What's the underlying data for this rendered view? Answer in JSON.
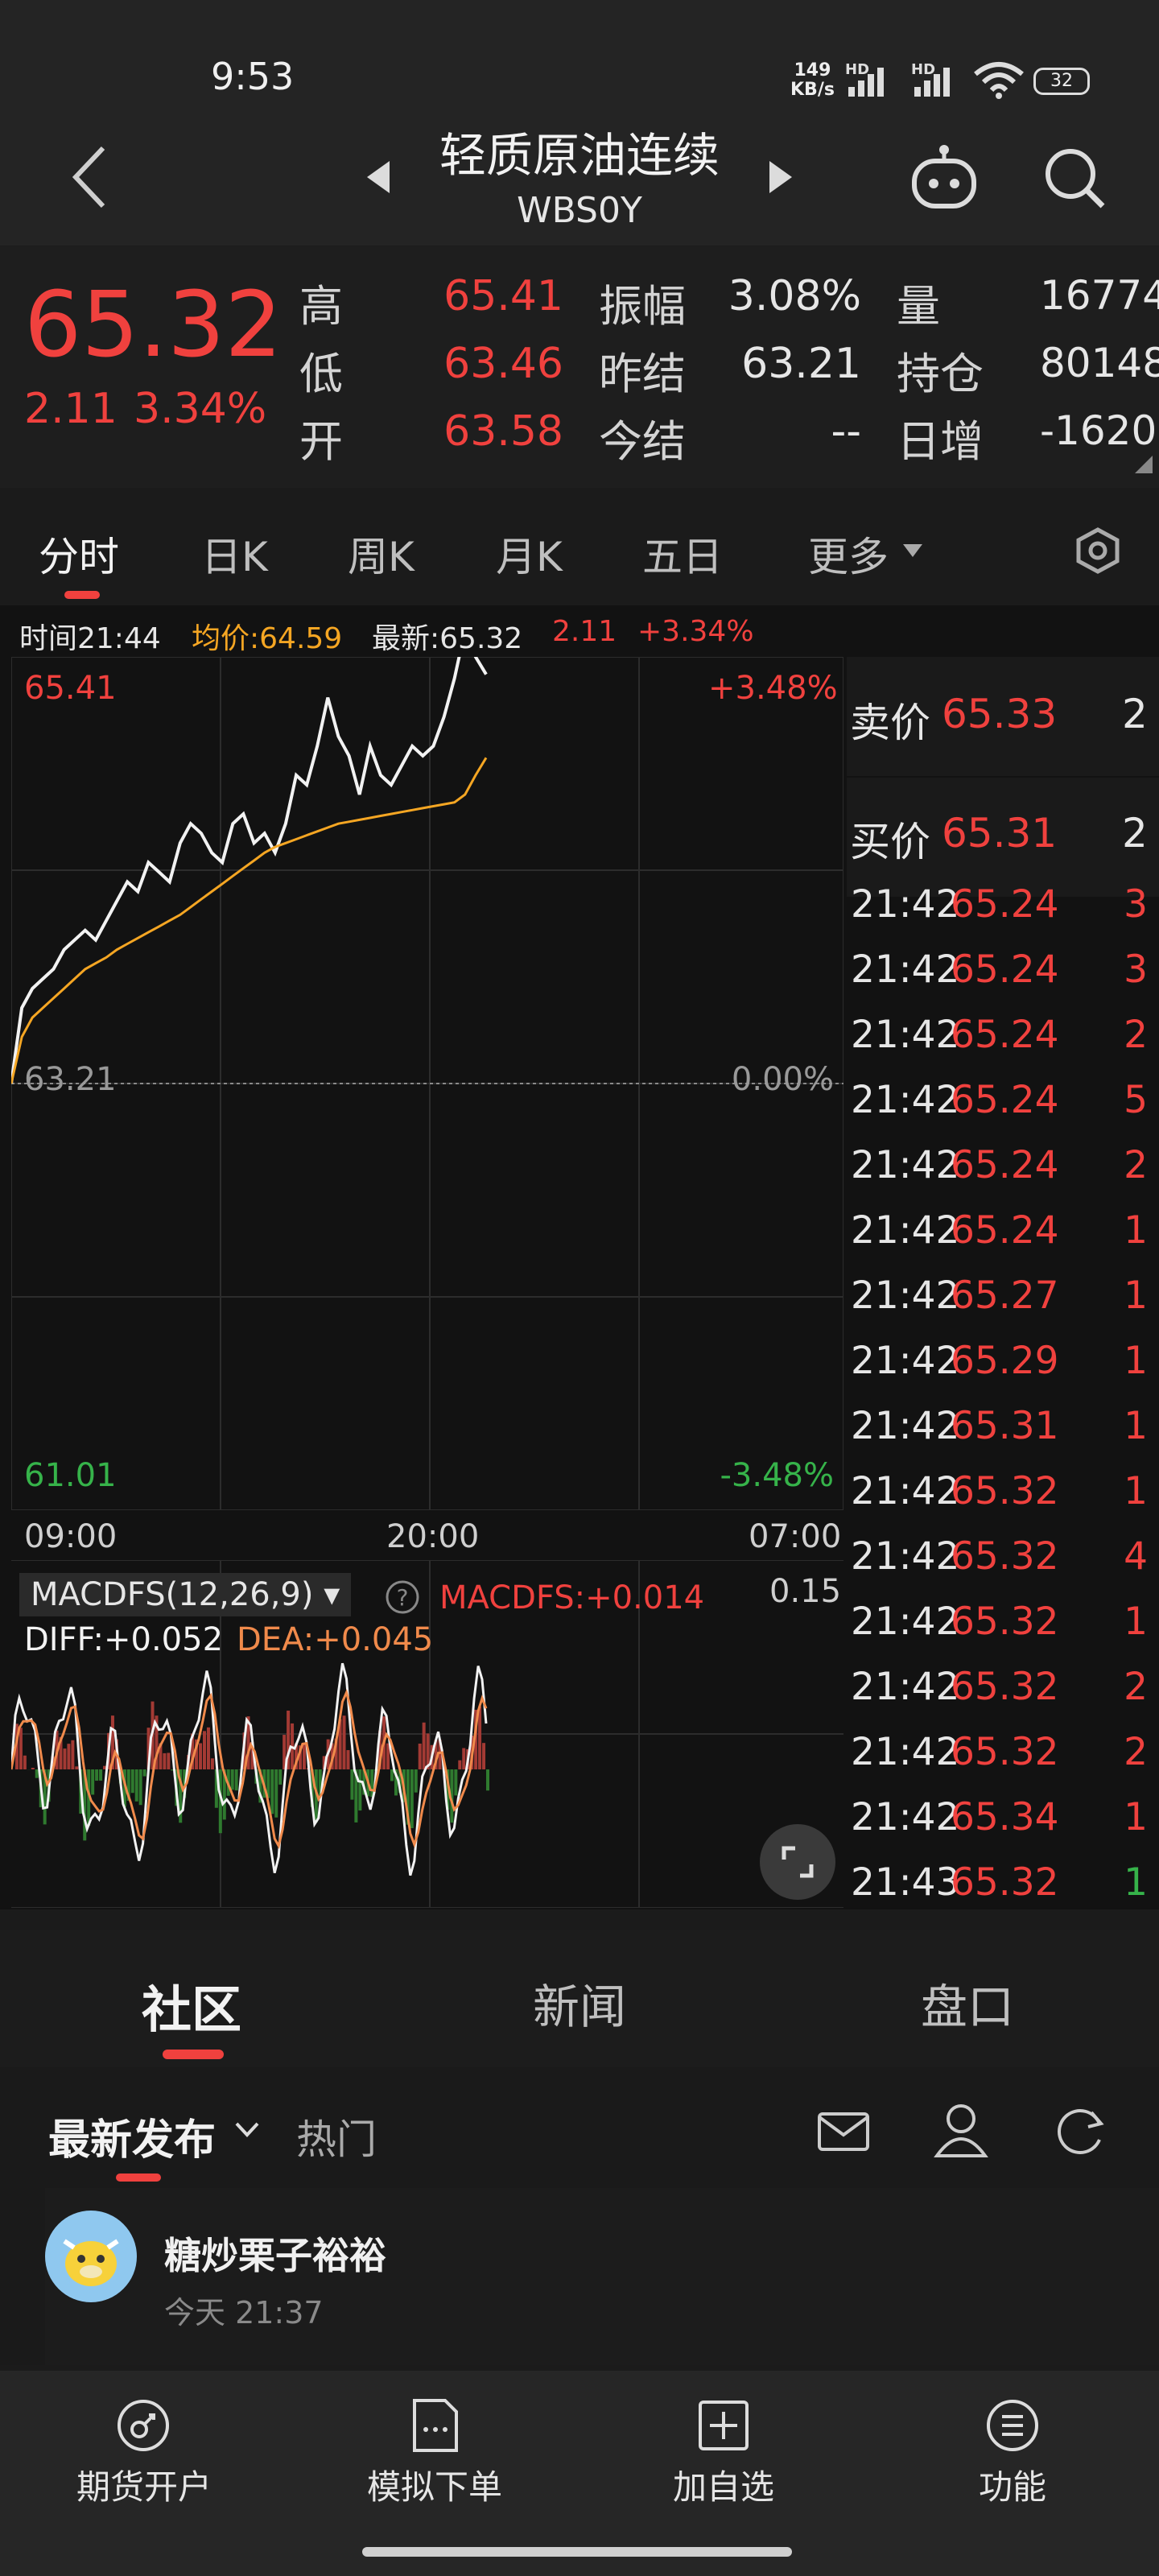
{
  "status_bar": {
    "time": "9:53",
    "net_speed_value": "149",
    "net_speed_unit": "KB/s",
    "signal_label_1": "HD",
    "signal_label_2": "HD",
    "battery": "32"
  },
  "header": {
    "title": "轻质原油连续",
    "code": "WBS0Y"
  },
  "quote": {
    "last": "65.32",
    "change": "2.11",
    "change_pct": "3.34%",
    "high_label": "高",
    "high": "65.41",
    "low_label": "低",
    "low": "63.46",
    "open_label": "开",
    "open": "63.58",
    "amplitude_label": "振幅",
    "amplitude": "3.08%",
    "prev_settle_label": "昨结",
    "prev_settle": "63.21",
    "today_settle_label": "今结",
    "today_settle": "--",
    "volume_label": "量",
    "volume": "16774",
    "oi_label": "持仓",
    "oi": "80148",
    "daily_inc_label": "日增",
    "daily_inc": "-1620"
  },
  "tabs": [
    "分时",
    "日K",
    "周K",
    "月K",
    "五日",
    "更多"
  ],
  "info_line": {
    "time": "时间21:44",
    "avg": "均价:64.59",
    "latest": "最新:65.32",
    "change": "2.11",
    "change_pct": "+3.34%"
  },
  "chart_data": {
    "type": "line",
    "title": "",
    "xlabel": "",
    "ylabel": "",
    "x_ticks": [
      "09:00",
      "20:00",
      "07:00"
    ],
    "ylim": [
      61.01,
      65.41
    ],
    "prev_close": 63.21,
    "y_labels": {
      "top": "65.41",
      "mid": "63.21",
      "bottom": "61.01",
      "top_pct": "+3.48%",
      "mid_pct": "0.00%",
      "bottom_pct": "-3.48%"
    },
    "series": [
      {
        "color": "#f2f2f2",
        "values": [
          63.21,
          63.6,
          63.7,
          63.75,
          63.8,
          63.9,
          63.95,
          64.0,
          63.95,
          64.05,
          64.15,
          64.25,
          64.2,
          64.35,
          64.3,
          64.25,
          64.45,
          64.55,
          64.5,
          64.4,
          64.35,
          64.55,
          64.6,
          64.45,
          64.5,
          64.4,
          64.55,
          64.8,
          64.75,
          64.95,
          65.2,
          65.0,
          64.9,
          64.7,
          64.95,
          64.8,
          64.75,
          64.85,
          64.95,
          64.9,
          64.95,
          65.1,
          65.3,
          65.55,
          65.41,
          65.32
        ]
      },
      {
        "color": "#f5a623",
        "values": [
          63.21,
          63.45,
          63.55,
          63.6,
          63.65,
          63.7,
          63.75,
          63.8,
          63.83,
          63.86,
          63.9,
          63.93,
          63.96,
          63.99,
          64.02,
          64.05,
          64.08,
          64.12,
          64.16,
          64.2,
          64.24,
          64.28,
          64.32,
          64.36,
          64.4,
          64.43,
          64.45,
          64.47,
          64.49,
          64.51,
          64.53,
          64.55,
          64.56,
          64.57,
          64.58,
          64.59,
          64.6,
          64.61,
          64.62,
          64.63,
          64.64,
          64.65,
          64.66,
          64.7,
          64.8,
          64.89
        ]
      }
    ]
  },
  "macd": {
    "name": "MACDFS(12,26,9)",
    "macdfs": "MACDFS:+0.014",
    "diff": "DIFF:+0.052",
    "dea": "DEA:+0.045",
    "scale": "0.15"
  },
  "order_book": {
    "ask_label": "卖价",
    "ask": "65.33",
    "ask_vol": "2",
    "bid_label": "买价",
    "bid": "65.31",
    "bid_vol": "2"
  },
  "ticks": [
    {
      "time": "21:42",
      "price": "65.24",
      "vol": "3",
      "color": "red"
    },
    {
      "time": "21:42",
      "price": "65.24",
      "vol": "3",
      "color": "red"
    },
    {
      "time": "21:42",
      "price": "65.24",
      "vol": "2",
      "color": "red"
    },
    {
      "time": "21:42",
      "price": "65.24",
      "vol": "5",
      "color": "red"
    },
    {
      "time": "21:42",
      "price": "65.24",
      "vol": "2",
      "color": "red"
    },
    {
      "time": "21:42",
      "price": "65.24",
      "vol": "1",
      "color": "red"
    },
    {
      "time": "21:42",
      "price": "65.27",
      "vol": "1",
      "color": "red"
    },
    {
      "time": "21:42",
      "price": "65.29",
      "vol": "1",
      "color": "red"
    },
    {
      "time": "21:42",
      "price": "65.31",
      "vol": "1",
      "color": "red"
    },
    {
      "time": "21:42",
      "price": "65.32",
      "vol": "1",
      "color": "red"
    },
    {
      "time": "21:42",
      "price": "65.32",
      "vol": "4",
      "color": "red"
    },
    {
      "time": "21:42",
      "price": "65.32",
      "vol": "1",
      "color": "red"
    },
    {
      "time": "21:42",
      "price": "65.32",
      "vol": "2",
      "color": "red"
    },
    {
      "time": "21:42",
      "price": "65.32",
      "vol": "2",
      "color": "red"
    },
    {
      "time": "21:42",
      "price": "65.34",
      "vol": "1",
      "color": "red"
    },
    {
      "time": "21:43",
      "price": "65.32",
      "vol": "1",
      "color": "green"
    }
  ],
  "community_tabs": [
    "社区",
    "新闻",
    "盘口"
  ],
  "feed_tabs": {
    "latest": "最新发布",
    "hot": "热门"
  },
  "post": {
    "author": "糖炒栗子裕裕",
    "time": "今天 21:37"
  },
  "bottom_nav": [
    "期货开户",
    "模拟下单",
    "加自选",
    "功能"
  ]
}
